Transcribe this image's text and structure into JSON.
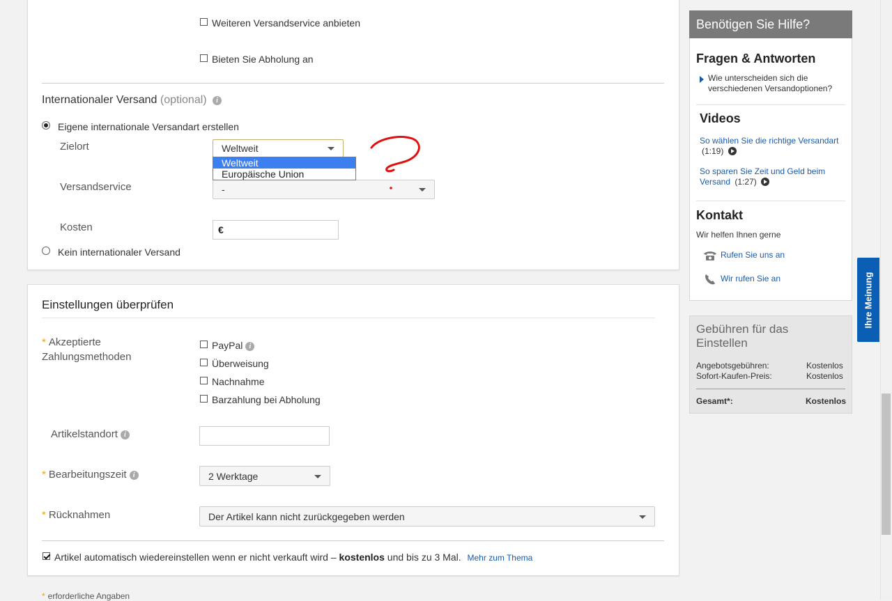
{
  "shipping": {
    "more_service": "Weiteren Versandservice anbieten",
    "pickup": "Bieten Sie Abholung an",
    "intl_title": "Internationaler Versand",
    "intl_optional": "(optional)",
    "own_intl": "Eigene internationale Versandart erstellen",
    "destination_label": "Zielort",
    "destination_value": "Weltweit",
    "destination_options": [
      "Weltweit",
      "Europäische Union"
    ],
    "service_label": "Versandservice",
    "service_value": "-",
    "cost_label": "Kosten",
    "cost_currency": "€",
    "no_intl": "Kein internationaler Versand"
  },
  "review": {
    "title": "Einstellungen überprüfen",
    "payment_label_1": "Akzeptierte",
    "payment_label_2": "Zahlungsmethoden",
    "payments": [
      "PayPal",
      "Überweisung",
      "Nachnahme",
      "Barzahlung bei Abholung"
    ],
    "location_label": "Artikelstandort",
    "location_value": "",
    "handling_label": "Bearbeitungszeit",
    "handling_value": "2 Werktage",
    "returns_label": "Rücknahmen",
    "returns_value": "Der Artikel kann nicht zurückgegeben werden",
    "relist_text_1": "Artikel automatisch wiedereinstellen wenn er nicht verkauft wird –",
    "relist_bold": "kostenlos",
    "relist_text_2": "und bis zu 3 Mal.",
    "relist_link": "Mehr zum Thema",
    "required_note": "erforderliche Angaben",
    "asterisk": "*"
  },
  "help": {
    "header": "Benötigen Sie Hilfe?",
    "faq_title": "Fragen & Antworten",
    "faq_link": "Wie unterscheiden sich die verschiedenen Versandoptionen?",
    "videos_title": "Videos",
    "video1_title": "So wählen Sie die richtige Versandart",
    "video1_time": "(1:19)",
    "video2_title": "So sparen Sie Zeit und Geld beim Versand",
    "video2_time": "(1:27)",
    "contact_title": "Kontakt",
    "contact_sub": "Wir helfen Ihnen gerne",
    "call_us": "Rufen Sie uns an",
    "we_call": "Wir rufen Sie an"
  },
  "fees": {
    "title": "Gebühren für das Einstellen",
    "listing_label": "Angebotsgebühren:",
    "listing_value": "Kostenlos",
    "bin_label": "Sofort-Kaufen-Preis:",
    "bin_value": "Kostenlos",
    "total_label": "Gesamt*:",
    "total_value": "Kostenlos"
  },
  "feedback_tab": "Ihre Meinung",
  "colors": {
    "accent_blue": "#1a5ba8",
    "dropdown_highlight": "#3b7ff0",
    "help_header": "#7a7a7a",
    "feedback_tab": "#0a5fb4",
    "annotation_red": "#e01010"
  }
}
